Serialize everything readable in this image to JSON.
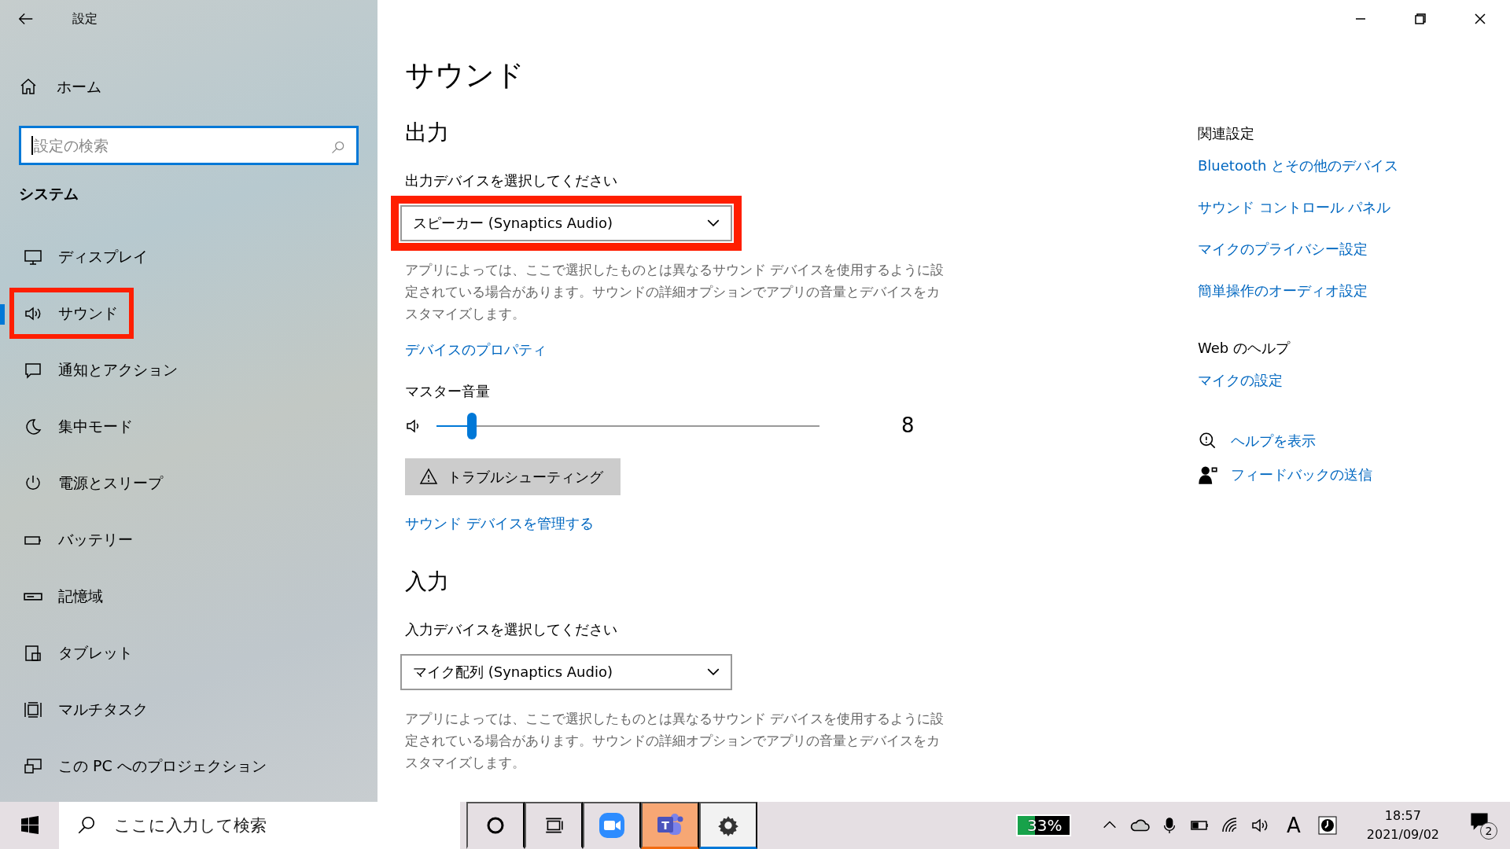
{
  "window": {
    "title": "設定"
  },
  "sidebar": {
    "home": "ホーム",
    "search": {
      "placeholder": "設定の検索",
      "focused": true
    },
    "section": "システム",
    "items": [
      {
        "kind": "display",
        "label": "ディスプレイ",
        "selected": false,
        "highlighted": false
      },
      {
        "kind": "sound",
        "label": "サウンド",
        "selected": true,
        "highlighted": true
      },
      {
        "kind": "notifications",
        "label": "通知とアクション",
        "selected": false,
        "highlighted": false
      },
      {
        "kind": "focus",
        "label": "集中モード",
        "selected": false,
        "highlighted": false
      },
      {
        "kind": "power",
        "label": "電源とスリープ",
        "selected": false,
        "highlighted": false
      },
      {
        "kind": "battery",
        "label": "バッテリー",
        "selected": false,
        "highlighted": false
      },
      {
        "kind": "storage",
        "label": "記憶域",
        "selected": false,
        "highlighted": false
      },
      {
        "kind": "tablet",
        "label": "タブレット",
        "selected": false,
        "highlighted": false
      },
      {
        "kind": "multitask",
        "label": "マルチタスク",
        "selected": false,
        "highlighted": false
      },
      {
        "kind": "projection",
        "label": "この PC へのプロジェクション",
        "selected": false,
        "highlighted": false
      }
    ]
  },
  "main": {
    "title": "サウンド",
    "output": {
      "heading": "出力",
      "label": "出力デバイスを選択してください",
      "device": "スピーカー (Synaptics Audio)",
      "highlighted": true,
      "description": "アプリによっては、ここで選択したものとは異なるサウンド デバイスを使用するように設定されている場合があります。サウンドの詳細オプションでアプリの音量とデバイスをカスタマイズします。",
      "properties_link": "デバイスのプロパティ",
      "volume_label": "マスター音量",
      "volume": {
        "level": 0.08,
        "reading": "8"
      },
      "troubleshoot": "トラブルシューティング",
      "manage_link": "サウンド デバイスを管理する"
    },
    "input": {
      "heading": "入力",
      "label": "入力デバイスを選択してください",
      "device": "マイク配列 (Synaptics Audio)",
      "highlighted": false,
      "description": "アプリによっては、ここで選択したものとは異なるサウンド デバイスを使用するように設定されている場合があります。サウンドの詳細オプションでアプリの音量とデバイスをカスタマイズします。"
    }
  },
  "related": {
    "heading": "関連設定",
    "links": [
      "Bluetooth とその他のデバイス",
      "サウンド コントロール パネル",
      "マイクのプライバシー設定",
      "簡単操作のオーディオ設定"
    ]
  },
  "web_help": {
    "heading": "Web のヘルプ",
    "links": [
      "マイクの設定"
    ]
  },
  "help": [
    {
      "kind": "help",
      "label": "ヘルプを表示"
    },
    {
      "kind": "feedback",
      "label": "フィードバックの送信"
    }
  ],
  "taskbar": {
    "search_placeholder": "ここに入力して検索",
    "apps": [
      {
        "kind": "cortana",
        "running": false,
        "flashing": false
      },
      {
        "kind": "task-view",
        "running": false,
        "flashing": false
      },
      {
        "kind": "zoom",
        "running": false,
        "flashing": false
      },
      {
        "kind": "teams",
        "label": "T",
        "running": true,
        "flashing": true
      },
      {
        "kind": "settings",
        "running": true,
        "flashing": false
      }
    ],
    "battery_widget": {
      "level": 0.33,
      "reading": "33%"
    },
    "ime": "A",
    "time": "18:57",
    "date": "2021/09/02",
    "notifications": "2"
  }
}
